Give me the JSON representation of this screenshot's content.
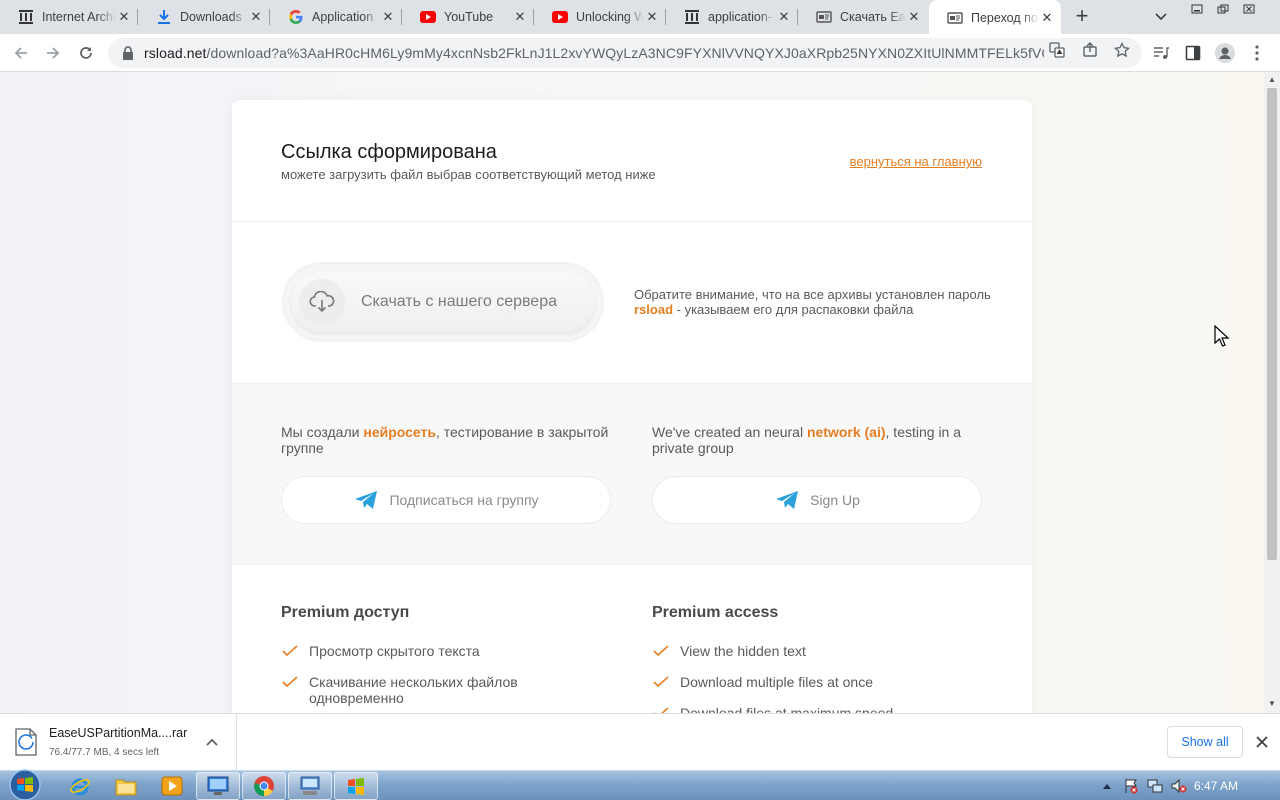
{
  "browser": {
    "tabs": [
      {
        "title": "Internet Archive",
        "icon": "archive-icon"
      },
      {
        "title": "Downloads",
        "icon": "download-icon"
      },
      {
        "title": "Application",
        "icon": "google-icon"
      },
      {
        "title": "YouTube",
        "icon": "youtube-icon"
      },
      {
        "title": "Unlocking W",
        "icon": "youtube-icon"
      },
      {
        "title": "application-",
        "icon": "archive-icon"
      },
      {
        "title": "Скачать Eas",
        "icon": "page-icon"
      },
      {
        "title": "Переход по",
        "icon": "page-icon",
        "active": true
      }
    ],
    "url_host": "rsload.net",
    "url_path": "/download?a%3AaHR0cHM6Ly9mMy4xcnNsb2FkLnJ1L2xvYWQyLzA3NC9FYXNlVVNQYXJ0aXRpb25NYXN0ZXItUlNMMTFELk5fVC0ucm..."
  },
  "page": {
    "heading": "Ссылка сформирована",
    "subheading": "можете загрузить файл выбрав соответствующий метод ниже",
    "back_link": "вернуться на главную",
    "download_button": "Скачать с нашего сервера",
    "note_part1": "Обратите внимание, что на все архивы установлен пароль ",
    "note_password": "rsload",
    "note_part2": " - указываем его для распаковки файла",
    "ru_promo_part1": "Мы создали ",
    "ru_promo_bold": "нейросеть",
    "ru_promo_part2": ", тестирование в закрытой группе",
    "en_promo_part1": "We've created an neural ",
    "en_promo_bold": "network (ai)",
    "en_promo_part2": ", testing in a private group",
    "ru_subscribe": "Подписаться на группу",
    "en_signup": "Sign Up",
    "premium_ru_title": "Premium доступ",
    "premium_en_title": "Premium access",
    "premium_ru_features": [
      "Просмотр скрытого текста",
      "Скачивание нескольких файлов одновременно"
    ],
    "premium_en_features": [
      "View the hidden text",
      "Download multiple files at once",
      "Download files at maximum speed"
    ]
  },
  "download_shelf": {
    "filename": "EaseUSPartitionMa....rar",
    "status": "76.4/77.7 MB, 4 secs left",
    "show_all": "Show all"
  },
  "taskbar": {
    "time": "6:47 AM"
  },
  "colors": {
    "accent": "#e67e22",
    "telegram": "#2aa1da"
  }
}
